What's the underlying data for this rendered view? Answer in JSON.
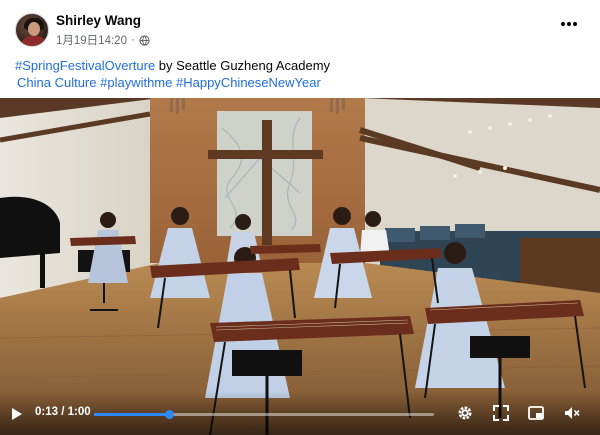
{
  "post": {
    "author": "Shirley Wang",
    "timestamp": "1月19日14:20",
    "separator": "·",
    "privacy_icon": "globe-icon",
    "more_icon": "more-horizontal-icon"
  },
  "caption": {
    "line1_tag": "#SpringFestivalOverture",
    "line1_text": " by Seattle Guzheng Academy",
    "line2_lead": " China Culture ",
    "line2_tag1": "#playwithme",
    "line2_space": " ",
    "line2_tag2": "#HappyChineseNewYear"
  },
  "video": {
    "time": "0:13 / 1:00",
    "progress": 0.22,
    "colors": {
      "accent": "#2d88ff",
      "link": "#216fdb"
    },
    "icons": [
      "play-icon",
      "settings-icon",
      "fullscreen-icon",
      "picture-in-picture-icon",
      "volume-muted-icon"
    ]
  }
}
